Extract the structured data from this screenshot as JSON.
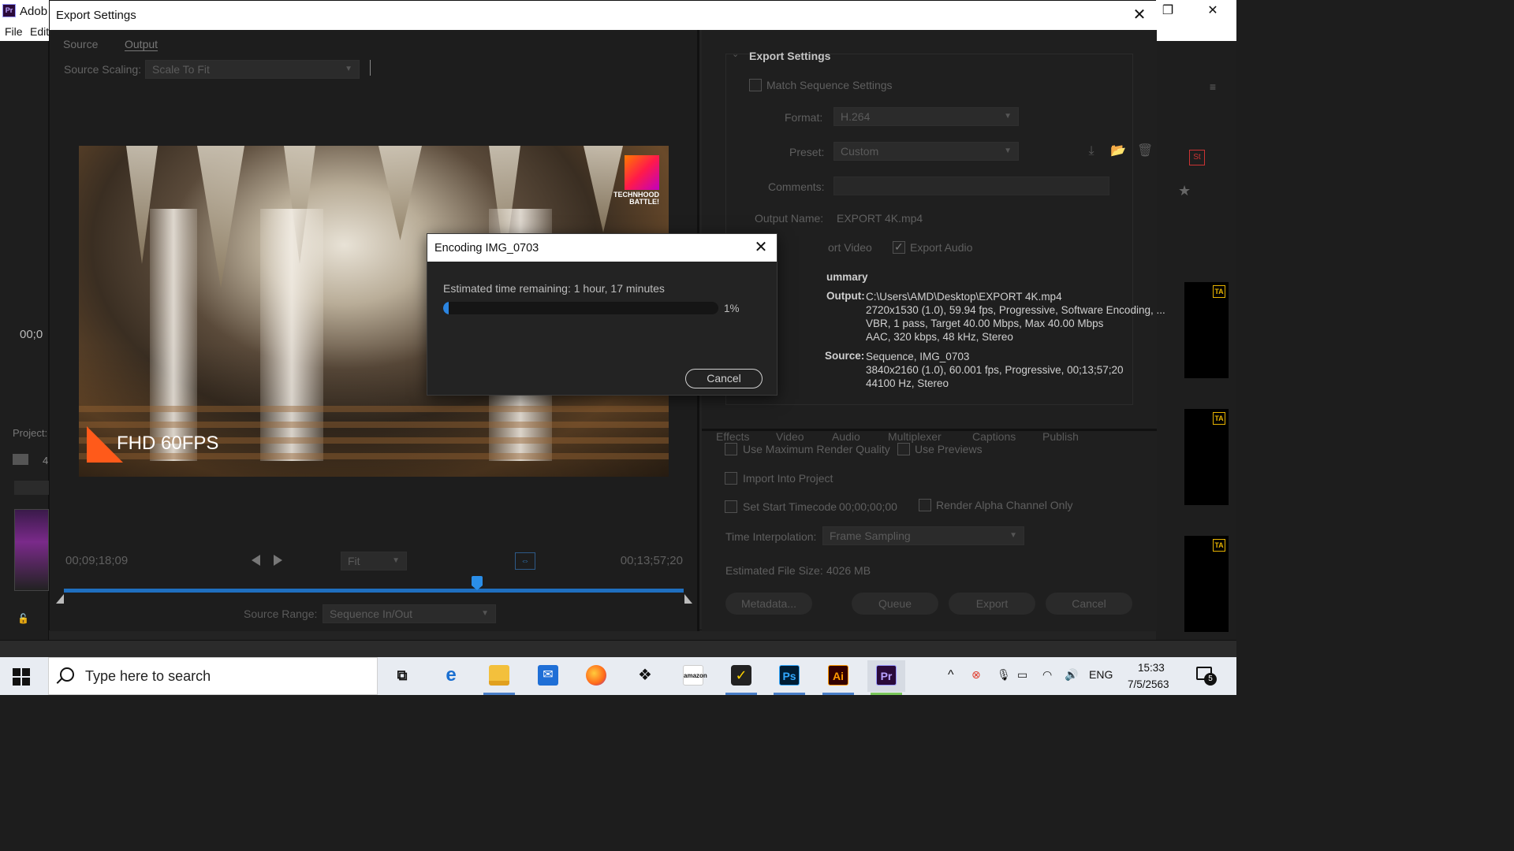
{
  "premiere": {
    "title": "Adob",
    "menu": [
      "File",
      "Edit"
    ],
    "left_timecode": "00;0",
    "project_label": "Project:",
    "project_count": "4"
  },
  "export_dialog": {
    "title": "Export Settings",
    "tabs": [
      "Source",
      "Output"
    ],
    "source_scaling_label": "Source Scaling:",
    "source_scaling_value": "Scale To Fit",
    "preview_badge": "FHD 60FPS",
    "preview_logo_text": "TECHNHOOD\nBATTLE!",
    "timecode_current": "00;09;18;09",
    "timecode_duration": "00;13;57;20",
    "fit_value": "Fit",
    "source_range_label": "Source Range:",
    "source_range_value": "Sequence In/Out",
    "settings": {
      "section_title": "Export Settings",
      "match_sequence": "Match Sequence Settings",
      "format_label": "Format:",
      "format_value": "H.264",
      "preset_label": "Preset:",
      "preset_value": "Custom",
      "comments_label": "Comments:",
      "output_name_label": "Output Name:",
      "output_name_value": "EXPORT 4K.mp4",
      "export_video": "ort Video",
      "export_audio": "Export Audio",
      "summary_title": "ummary",
      "output_head": "Output:",
      "output_lines": [
        "C:\\Users\\AMD\\Desktop\\EXPORT 4K.mp4",
        "2720x1530 (1.0), 59.94 fps, Progressive, Software Encoding, ...",
        "VBR, 1 pass, Target 40.00 Mbps, Max 40.00 Mbps",
        "AAC, 320 kbps, 48 kHz, Stereo"
      ],
      "source_head": "Source:",
      "source_lines": [
        "Sequence, IMG_0703",
        "3840x2160 (1.0), 60.001 fps, Progressive, 00;13;57;20",
        "44100 Hz, Stereo"
      ]
    },
    "right_tabs": [
      "Effects",
      "Video",
      "Audio",
      "Multiplexer",
      "Captions",
      "Publish"
    ],
    "options": {
      "max_render_quality": "Use Maximum Render Quality",
      "use_previews": "Use Previews",
      "import_into_project": "Import Into Project",
      "set_start_timecode": "Set Start Timecode",
      "start_timecode_value": "00;00;00;00",
      "render_alpha": "Render Alpha Channel Only",
      "time_interp_label": "Time Interpolation:",
      "time_interp_value": "Frame Sampling",
      "est_size_label": "Estimated File Size:",
      "est_size_value": "4026 MB"
    },
    "buttons": [
      "Metadata...",
      "Queue",
      "Export",
      "Cancel"
    ]
  },
  "encoding_dialog": {
    "title": "Encoding IMG_0703",
    "estimate": "Estimated time remaining: 1 hour, 17 minutes",
    "progress_percent": 1,
    "progress_label": "1%",
    "cancel": "Cancel"
  },
  "taskbar": {
    "search_placeholder": "Type here to search",
    "apps": [
      "task-view",
      "edge",
      "file-explorer",
      "mail",
      "firefox",
      "dropbox",
      "amazon",
      "norton",
      "photoshop",
      "illustrator",
      "premiere"
    ],
    "language": "ENG",
    "time": "15:33",
    "date": "7/5/2563",
    "notification_count": "5"
  },
  "colors": {
    "accent_blue": "#2b84e0",
    "panel_bg": "#232323"
  }
}
